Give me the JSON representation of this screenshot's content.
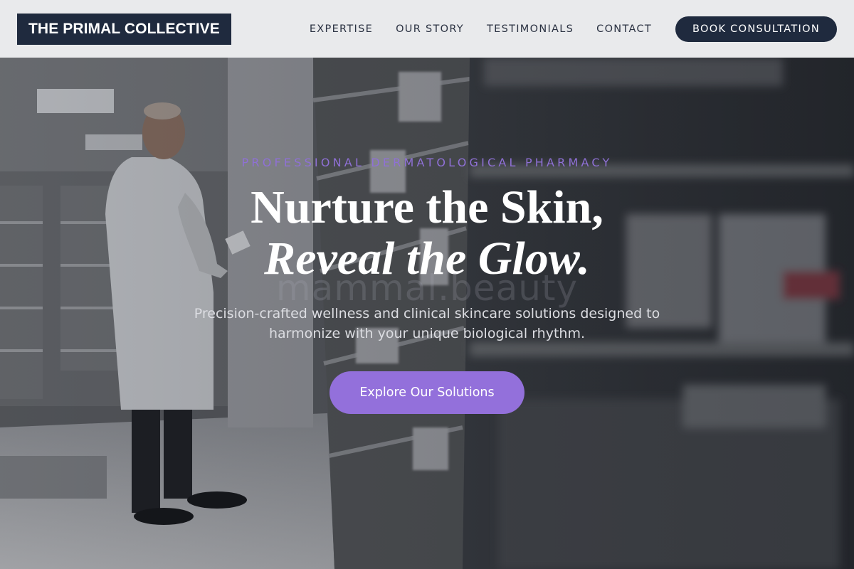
{
  "brand": {
    "name": "THE PRIMAL COLLECTIVE"
  },
  "nav": {
    "links": [
      "EXPERTISE",
      "OUR STORY",
      "TESTIMONIALS",
      "CONTACT"
    ],
    "cta_label": "BOOK CONSULTATION"
  },
  "hero": {
    "eyebrow": "PROFESSIONAL DERMATOLOGICAL PHARMACY",
    "headline_line1": "Nurture the Skin,",
    "headline_line2": "Reveal the Glow.",
    "watermark": "mammal.beauty",
    "subtitle": "Precision-crafted wellness and clinical skincare solutions designed to harmonize with your unique biological rhythm.",
    "cta_label": "Explore Our Solutions"
  },
  "colors": {
    "brand_navy": "#1f2a3e",
    "accent_purple": "#9370db",
    "eyebrow_purple": "#8f70d6",
    "header_bg": "#e9eaec"
  }
}
